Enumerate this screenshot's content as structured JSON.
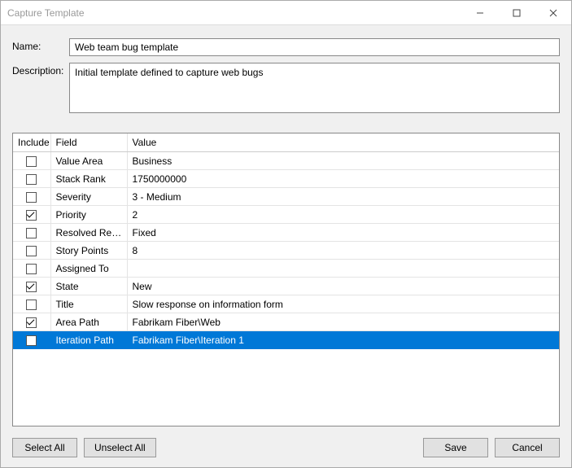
{
  "window": {
    "title": "Capture Template"
  },
  "form": {
    "name_label": "Name:",
    "name_value": "Web team bug template",
    "desc_label": "Description:",
    "desc_value": "Initial template defined to capture web bugs"
  },
  "table": {
    "headers": {
      "include": "Include",
      "field": "Field",
      "value": "Value"
    },
    "rows": [
      {
        "include": false,
        "field": "Value Area",
        "value": "Business",
        "selected": false
      },
      {
        "include": false,
        "field": "Stack Rank",
        "value": "1750000000",
        "selected": false
      },
      {
        "include": false,
        "field": "Severity",
        "value": "3 - Medium",
        "selected": false
      },
      {
        "include": true,
        "field": "Priority",
        "value": "2",
        "selected": false
      },
      {
        "include": false,
        "field": "Resolved Reason",
        "value": "Fixed",
        "selected": false
      },
      {
        "include": false,
        "field": "Story Points",
        "value": "8",
        "selected": false
      },
      {
        "include": false,
        "field": "Assigned To",
        "value": "",
        "selected": false
      },
      {
        "include": true,
        "field": "State",
        "value": "New",
        "selected": false
      },
      {
        "include": false,
        "field": "Title",
        "value": "Slow response on information form",
        "selected": false
      },
      {
        "include": true,
        "field": "Area Path",
        "value": "Fabrikam Fiber\\Web",
        "selected": false
      },
      {
        "include": false,
        "field": "Iteration Path",
        "value": "Fabrikam Fiber\\Iteration 1",
        "selected": true
      }
    ]
  },
  "buttons": {
    "select_all": "Select All",
    "unselect_all": "Unselect All",
    "save": "Save",
    "cancel": "Cancel"
  }
}
